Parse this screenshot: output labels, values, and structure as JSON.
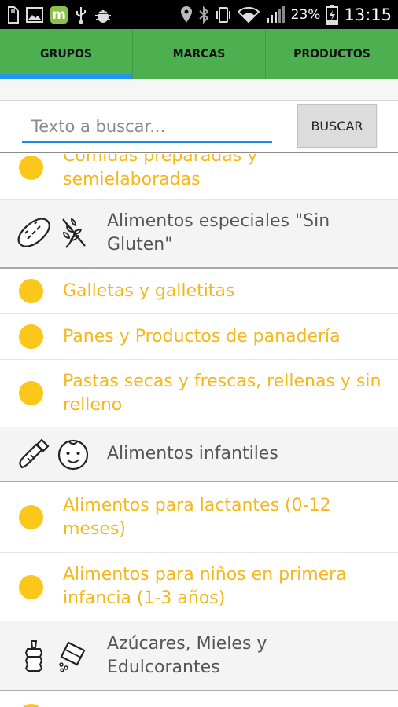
{
  "status_bar": {
    "battery_percent": "23%",
    "time": "13:15"
  },
  "tabs": [
    {
      "label": "GRUPOS"
    },
    {
      "label": "MARCAS"
    },
    {
      "label": "PRODUCTOS"
    }
  ],
  "search": {
    "placeholder": "Texto a buscar...",
    "button_label": "BUSCAR"
  },
  "list": {
    "rows": [
      {
        "type": "item",
        "label": "Comidas preparadas y semielaboradas"
      },
      {
        "type": "group",
        "label": "Alimentos especiales \"Sin Gluten\"",
        "icons": [
          "bread-icon",
          "wheat-crossed-icon"
        ]
      },
      {
        "type": "item",
        "label": "Galletas y galletitas"
      },
      {
        "type": "item",
        "label": "Panes y Productos de panadería"
      },
      {
        "type": "item",
        "label": "Pastas secas y frescas, rellenas y sin relleno"
      },
      {
        "type": "group",
        "label": "Alimentos infantiles",
        "icons": [
          "baby-bottle-icon",
          "baby-face-icon"
        ]
      },
      {
        "type": "item",
        "label": "Alimentos para lactantes (0-12 meses)"
      },
      {
        "type": "item",
        "label": "Alimentos para niños en primera infancia (1-3 años)"
      },
      {
        "type": "group",
        "label": "Azúcares, Mieles y Edulcorantes",
        "icons": [
          "honey-jar-icon",
          "sugar-packet-icon"
        ]
      }
    ]
  },
  "colors": {
    "tab_bar": "#4caf50",
    "tab_indicator": "#2196f3",
    "item_text": "#f5b71a",
    "item_dot": "#fcc71b",
    "group_text": "#555555",
    "search_underline": "#1e88e5"
  }
}
